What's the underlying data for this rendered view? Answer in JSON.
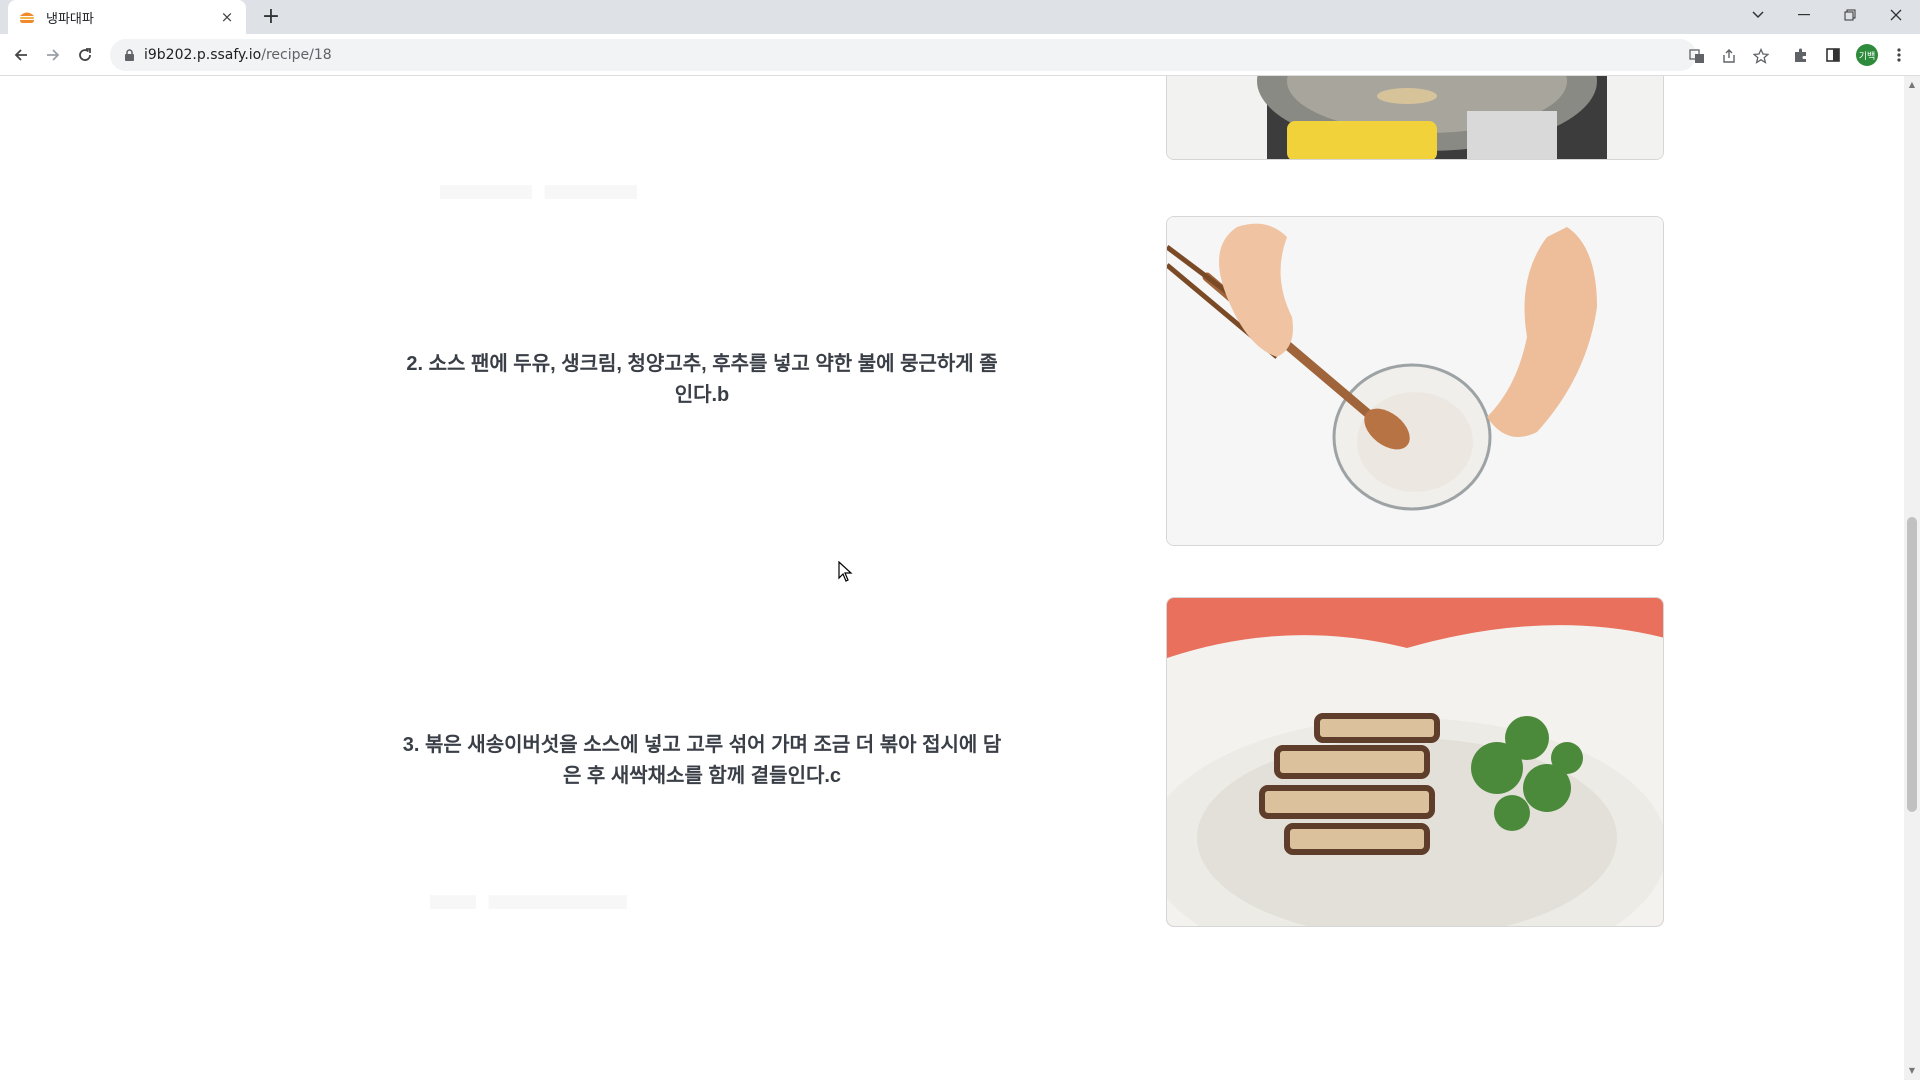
{
  "browser": {
    "tab_title": "냉파대파",
    "url_host": "i9b202.p.ssafy.io",
    "url_path": "/recipe/18",
    "profile_initials": "기백",
    "tab_close_glyph": "×",
    "new_tab_glyph": "+"
  },
  "recipe": {
    "steps": [
      {
        "text": "2. 소스 팬에 두유, 생크림, 청양고추, 후추를 넣고 약한 불에 뭉근하게 졸인다.b"
      },
      {
        "text": "3. 볶은 새송이버섯을 소스에 넣고 고루 섞어 가며 조금 더 볶아 접시에 담은 후 새싹채소를 함께 곁들인다.c"
      }
    ]
  },
  "icons": {
    "favicon": "burger-icon",
    "back": "arrow-left-icon",
    "forward": "arrow-right-icon",
    "reload": "reload-icon",
    "lock": "lock-icon",
    "translate": "translate-icon",
    "share": "share-icon",
    "bookmark": "star-icon",
    "extensions": "puzzle-icon",
    "side_panel": "side-panel-icon",
    "menu": "kebab-menu-icon"
  },
  "colors": {
    "tab_strip": "#dee1e6",
    "step_text": "#3a3f47",
    "plate_background": "#e8705c",
    "profile": "#2e8b3c"
  }
}
